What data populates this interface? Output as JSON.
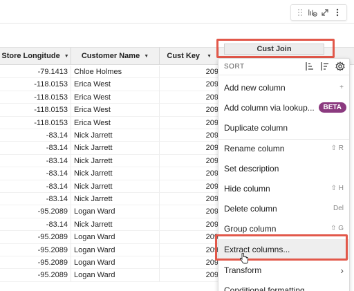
{
  "toolbar": {
    "icons": [
      "drag-handle-icon",
      "add-element-icon",
      "expand-icon",
      "more-icon"
    ]
  },
  "table": {
    "headers": [
      {
        "label": "Store Longitude"
      },
      {
        "label": "Customer Name"
      },
      {
        "label": "Cust Key"
      },
      {
        "label": "Cust Join"
      }
    ],
    "rows": [
      {
        "lon": "-79.1413",
        "name": "Chloe Holmes",
        "key": "209"
      },
      {
        "lon": "-118.0153",
        "name": "Erica West",
        "key": "209"
      },
      {
        "lon": "-118.0153",
        "name": "Erica West",
        "key": "209"
      },
      {
        "lon": "-118.0153",
        "name": "Erica West",
        "key": "209"
      },
      {
        "lon": "-118.0153",
        "name": "Erica West",
        "key": "209"
      },
      {
        "lon": "-83.14",
        "name": "Nick Jarrett",
        "key": "209"
      },
      {
        "lon": "-83.14",
        "name": "Nick Jarrett",
        "key": "209"
      },
      {
        "lon": "-83.14",
        "name": "Nick Jarrett",
        "key": "209"
      },
      {
        "lon": "-83.14",
        "name": "Nick Jarrett",
        "key": "209"
      },
      {
        "lon": "-83.14",
        "name": "Nick Jarrett",
        "key": "209"
      },
      {
        "lon": "-83.14",
        "name": "Nick Jarrett",
        "key": "209"
      },
      {
        "lon": "-95.2089",
        "name": "Logan Ward",
        "key": "209"
      },
      {
        "lon": "-83.14",
        "name": "Nick Jarrett",
        "key": "209"
      },
      {
        "lon": "-95.2089",
        "name": "Logan Ward",
        "key": "209"
      },
      {
        "lon": "-95.2089",
        "name": "Logan Ward",
        "key": "209"
      },
      {
        "lon": "-95.2089",
        "name": "Logan Ward",
        "key": "209"
      },
      {
        "lon": "-95.2089",
        "name": "Logan Ward",
        "key": "209"
      }
    ]
  },
  "menu": {
    "sort_label": "SORT",
    "items": [
      {
        "label": "Add new column",
        "shortcut": "+"
      },
      {
        "label": "Add column via lookup...",
        "badge": "BETA"
      },
      {
        "label": "Duplicate column",
        "shortcut": ""
      },
      {
        "label": "Rename column",
        "shortcut": "⇧ R"
      },
      {
        "label": "Set description",
        "shortcut": ""
      },
      {
        "label": "Hide column",
        "shortcut": "⇧ H"
      },
      {
        "label": "Delete column",
        "shortcut": "Del"
      },
      {
        "label": "Group column",
        "shortcut": "⇧ G"
      },
      {
        "label": "Extract columns...",
        "shortcut": ""
      },
      {
        "label": "Transform",
        "shortcut": "›"
      },
      {
        "label": "Conditional formatting",
        "shortcut": ""
      }
    ]
  },
  "colors": {
    "highlight": "#e2584a",
    "beta_badge": "#8b3a7f"
  }
}
